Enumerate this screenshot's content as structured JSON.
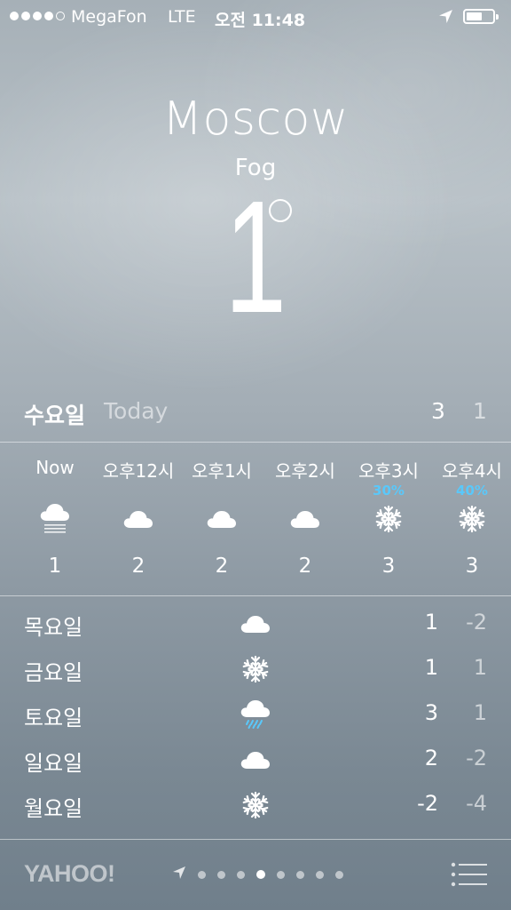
{
  "status_bar": {
    "carrier": "MegaFon",
    "network": "LTE",
    "time": "오전 11:48",
    "signal_bars_filled": 4,
    "signal_bars_total": 5
  },
  "current": {
    "city": "Moscow",
    "condition": "Fog",
    "temperature": "1"
  },
  "today": {
    "day": "수요일",
    "label": "Today",
    "high": "3",
    "low": "1"
  },
  "hourly": [
    {
      "label": "Now",
      "pop": "",
      "icon": "fog-icon",
      "temp": "1"
    },
    {
      "label": "오후12시",
      "pop": "",
      "icon": "cloud-icon",
      "temp": "2"
    },
    {
      "label": "오후1시",
      "pop": "",
      "icon": "cloud-icon",
      "temp": "2"
    },
    {
      "label": "오후2시",
      "pop": "",
      "icon": "cloud-icon",
      "temp": "2"
    },
    {
      "label": "오후3시",
      "pop": "30%",
      "icon": "snowflake-icon",
      "temp": "3"
    },
    {
      "label": "오후4시",
      "pop": "40%",
      "icon": "snowflake-icon",
      "temp": "3"
    }
  ],
  "daily": [
    {
      "day": "목요일",
      "icon": "cloud-icon",
      "high": "1",
      "low": "-2"
    },
    {
      "day": "금요일",
      "icon": "snowflake-icon",
      "high": "1",
      "low": "1"
    },
    {
      "day": "토요일",
      "icon": "cloud-rain-icon",
      "high": "3",
      "low": "1"
    },
    {
      "day": "일요일",
      "icon": "cloud-icon",
      "high": "2",
      "low": "-2"
    },
    {
      "day": "월요일",
      "icon": "snowflake-icon",
      "high": "-2",
      "low": "-4"
    }
  ],
  "footer": {
    "provider": "YAHOO!",
    "page_count": 8,
    "active_page": 4
  },
  "colors": {
    "precip_blue": "#5ac8fa"
  }
}
